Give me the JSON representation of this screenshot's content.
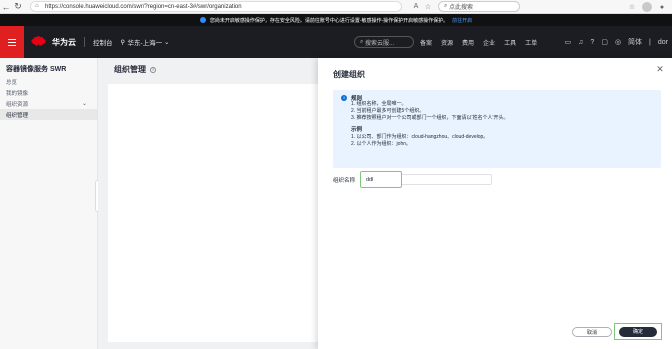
{
  "browser": {
    "url": "https://console.huaweicloud.com/swr/?region=cn-east-3#/swr/organization",
    "search_placeholder": "点此搜索"
  },
  "notice": {
    "text": "您尚未开启敏感操作保护，存在安全风险。请前往账号中心进行设置-敏感操作-操作保护开启敏感操作保护。",
    "link": "前往开启"
  },
  "header": {
    "brand": "华为云",
    "console": "控制台",
    "region": "华东-上海一",
    "search": "搜索云服...",
    "links": [
      "备案",
      "资源",
      "费用",
      "企业",
      "工具",
      "工单"
    ],
    "lang": "简体",
    "user": "dor"
  },
  "sidenav": {
    "title": "容器镜像服务 SWR",
    "items": [
      {
        "label": "总览"
      },
      {
        "label": "我的镜像"
      },
      {
        "label": "组织资源"
      },
      {
        "label": "组织管理"
      }
    ]
  },
  "main": {
    "title": "组织管理"
  },
  "drawer": {
    "title": "创建组织",
    "rules_title": "规则",
    "rules": [
      "1. 组织名称，全局唯一。",
      "2. 当前租户最多可创建5个组织。",
      "3. 推荐按照租户对一个公司或部门一个组织，下面请以'姓名个人'开头。"
    ],
    "examples_title": "示例",
    "examples": [
      "1. 以公司、部门作为组织：cloud-hangzhou、cloud-develop。",
      "2. 以个人作为组织：john。"
    ],
    "field_label": "组织名称",
    "field_value": "ddl",
    "cancel": "取消",
    "ok": "确定"
  }
}
